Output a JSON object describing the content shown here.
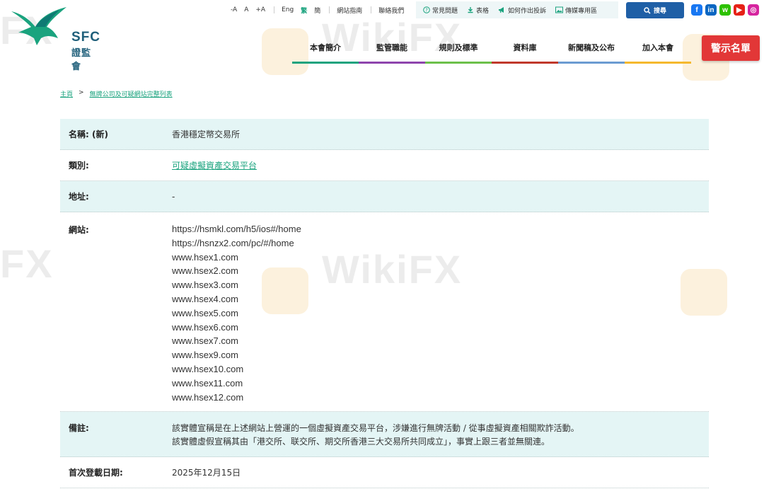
{
  "logo": {
    "abbr": "SFC",
    "name_cn": "證監會"
  },
  "utility": {
    "font_sizes": [
      "-A",
      "A",
      "+A"
    ],
    "languages": [
      "Eng",
      "繁",
      "簡"
    ],
    "active_language": "繁",
    "links": [
      "網站指南",
      "聯絡我們"
    ],
    "quick_links": [
      {
        "label": "常見問題",
        "icon": "question-icon"
      },
      {
        "label": "表格",
        "icon": "download-icon"
      },
      {
        "label": "如何作出投訴",
        "icon": "megaphone-icon"
      },
      {
        "label": "傳媒專用區",
        "icon": "image-icon"
      }
    ],
    "search_label": "搜尋"
  },
  "social": [
    {
      "name": "facebook-icon",
      "color": "#1877f2",
      "glyph": "f"
    },
    {
      "name": "linkedin-icon",
      "color": "#0a66c2",
      "glyph": "in"
    },
    {
      "name": "wechat-icon",
      "color": "#2dc100",
      "glyph": "w"
    },
    {
      "name": "youtube-icon",
      "color": "#e62117",
      "glyph": "▶"
    },
    {
      "name": "instagram-icon",
      "color": "#d6249f",
      "glyph": "◎"
    }
  ],
  "nav": [
    {
      "label": "本會簡介",
      "color": "#1aa37e"
    },
    {
      "label": "監管職能",
      "color": "#8e44ad"
    },
    {
      "label": "規則及標準",
      "color": "#6cc04a"
    },
    {
      "label": "資料庫",
      "color": "#c0392b"
    },
    {
      "label": "新聞稿及公布",
      "color": "#6b9bd1"
    },
    {
      "label": "加入本會",
      "color": "#f5b82e"
    }
  ],
  "alert_list_label": "警示名單",
  "breadcrumb": [
    "主頁",
    ">",
    "無牌公司及可疑網站完整列表"
  ],
  "record": {
    "name_label": "名稱: (新)",
    "name_value": "香港穩定幣交易所",
    "category_label": "類別:",
    "category_value": "可疑虛擬資產交易平台",
    "address_label": "地址:",
    "address_value": "-",
    "website_label": "網站:",
    "websites": [
      "https://hsmkl.com/h5/ios#/home",
      "https://hsnzx2.com/pc/#/home",
      "www.hsex1.com",
      "www.hsex2.com",
      "www.hsex3.com",
      "www.hsex4.com",
      "www.hsex5.com",
      "www.hsex6.com",
      "www.hsex7.com",
      "www.hsex9.com",
      "www.hsex10.com",
      "www.hsex11.com",
      "www.hsex12.com"
    ],
    "remarks_label": "備註:",
    "remarks": [
      "該實體宣稱是在上述網站上營運的一個虛擬資產交易平台，涉嫌進行無牌活動 / 從事虛擬資產相關欺詐活動。",
      "該實體虛假宣稱其由「港交所、联交所、期交所香港三大交易所共同成立」，事實上跟三者並無關連。"
    ],
    "first_date_label": "首次登載日期:",
    "first_date_value": "2025年12月15日"
  },
  "watermark": "WikiFX"
}
